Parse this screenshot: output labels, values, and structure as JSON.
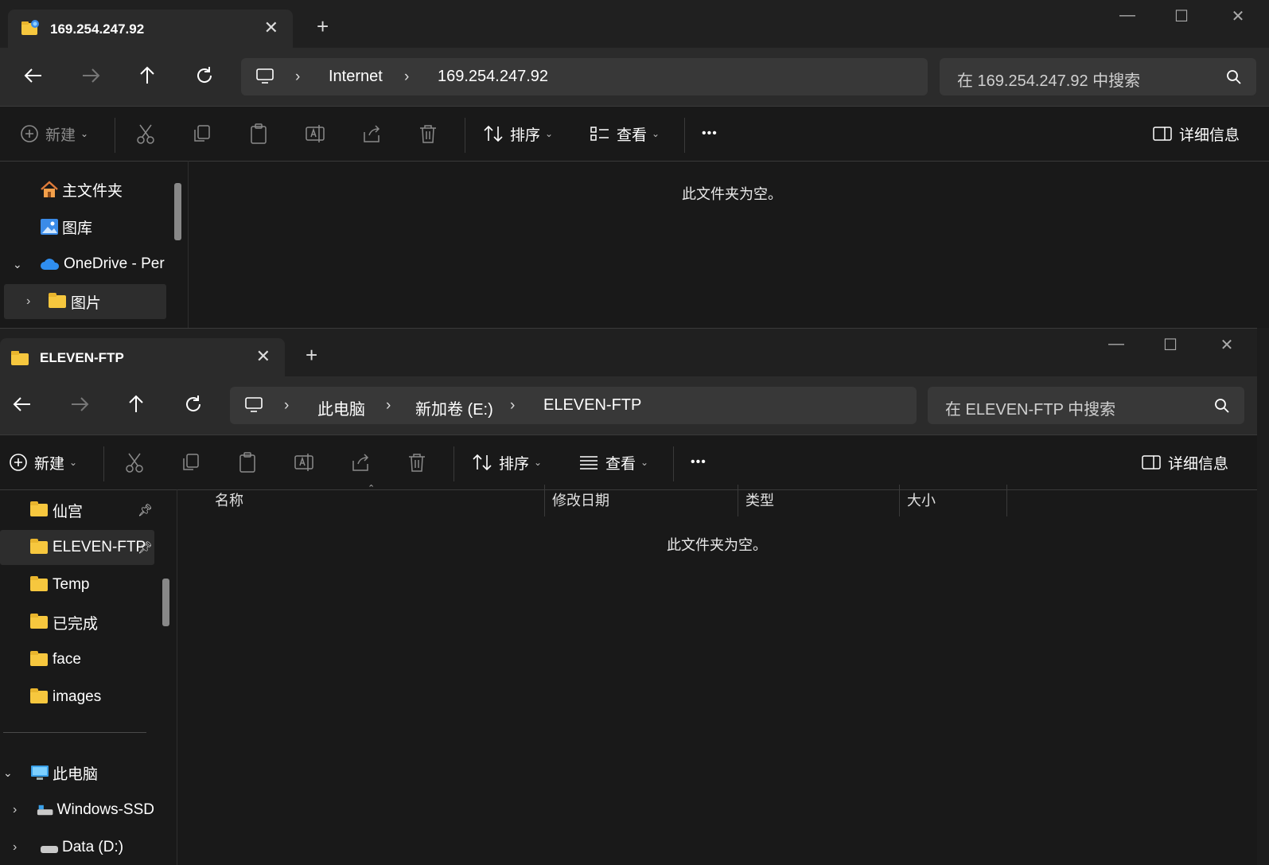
{
  "window1": {
    "tab_title": "169.254.247.92",
    "tab_close": "✕",
    "new_tab": "+",
    "window_controls": {
      "minimize": "—",
      "maximize": "☐",
      "close": "✕"
    },
    "breadcrumb": [
      "Internet",
      "169.254.247.92"
    ],
    "search_placeholder": "在 169.254.247.92 中搜索",
    "toolbar": {
      "new": "新建",
      "sort": "排序",
      "view": "查看",
      "more": "•••",
      "details": "详细信息"
    },
    "sidebar": [
      {
        "label": "主文件夹",
        "icon": "home-icon"
      },
      {
        "label": "图库",
        "icon": "gallery-icon"
      },
      {
        "label": "OneDrive - Per",
        "icon": "onedrive-icon",
        "expanded": true
      },
      {
        "label": "图片",
        "icon": "folder-icon",
        "selected": true
      }
    ],
    "empty_message": "此文件夹为空。"
  },
  "window2": {
    "tab_title": "ELEVEN-FTP",
    "tab_close": "✕",
    "new_tab": "+",
    "window_controls": {
      "minimize": "—",
      "maximize": "☐",
      "close": "✕"
    },
    "breadcrumb": [
      "此电脑",
      "新加卷 (E:)",
      "ELEVEN-FTP"
    ],
    "search_placeholder": "在 ELEVEN-FTP 中搜索",
    "toolbar": {
      "new": "新建",
      "sort": "排序",
      "view": "查看",
      "more": "•••",
      "details": "详细信息"
    },
    "sidebar": [
      {
        "label": "仙宫",
        "icon": "folder-icon",
        "pinned": true
      },
      {
        "label": "ELEVEN-FTP",
        "icon": "folder-icon",
        "pinned": true,
        "selected": true
      },
      {
        "label": "Temp",
        "icon": "folder-icon"
      },
      {
        "label": "已完成",
        "icon": "folder-icon"
      },
      {
        "label": "face",
        "icon": "folder-icon"
      },
      {
        "label": "images",
        "icon": "folder-icon"
      },
      {
        "label": "此电脑",
        "icon": "computer-icon",
        "expanded": true
      },
      {
        "label": "Windows-SSD",
        "icon": "drive-icon"
      },
      {
        "label": "Data (D:)",
        "icon": "drive-icon"
      }
    ],
    "columns": [
      "名称",
      "修改日期",
      "类型",
      "大小"
    ],
    "empty_message": "此文件夹为空。"
  },
  "colors": {
    "background": "#191919",
    "toolbar": "#2b2b2b",
    "address": "#383838",
    "folder": "#f6c73e",
    "onedrive": "#2f8ef0"
  }
}
